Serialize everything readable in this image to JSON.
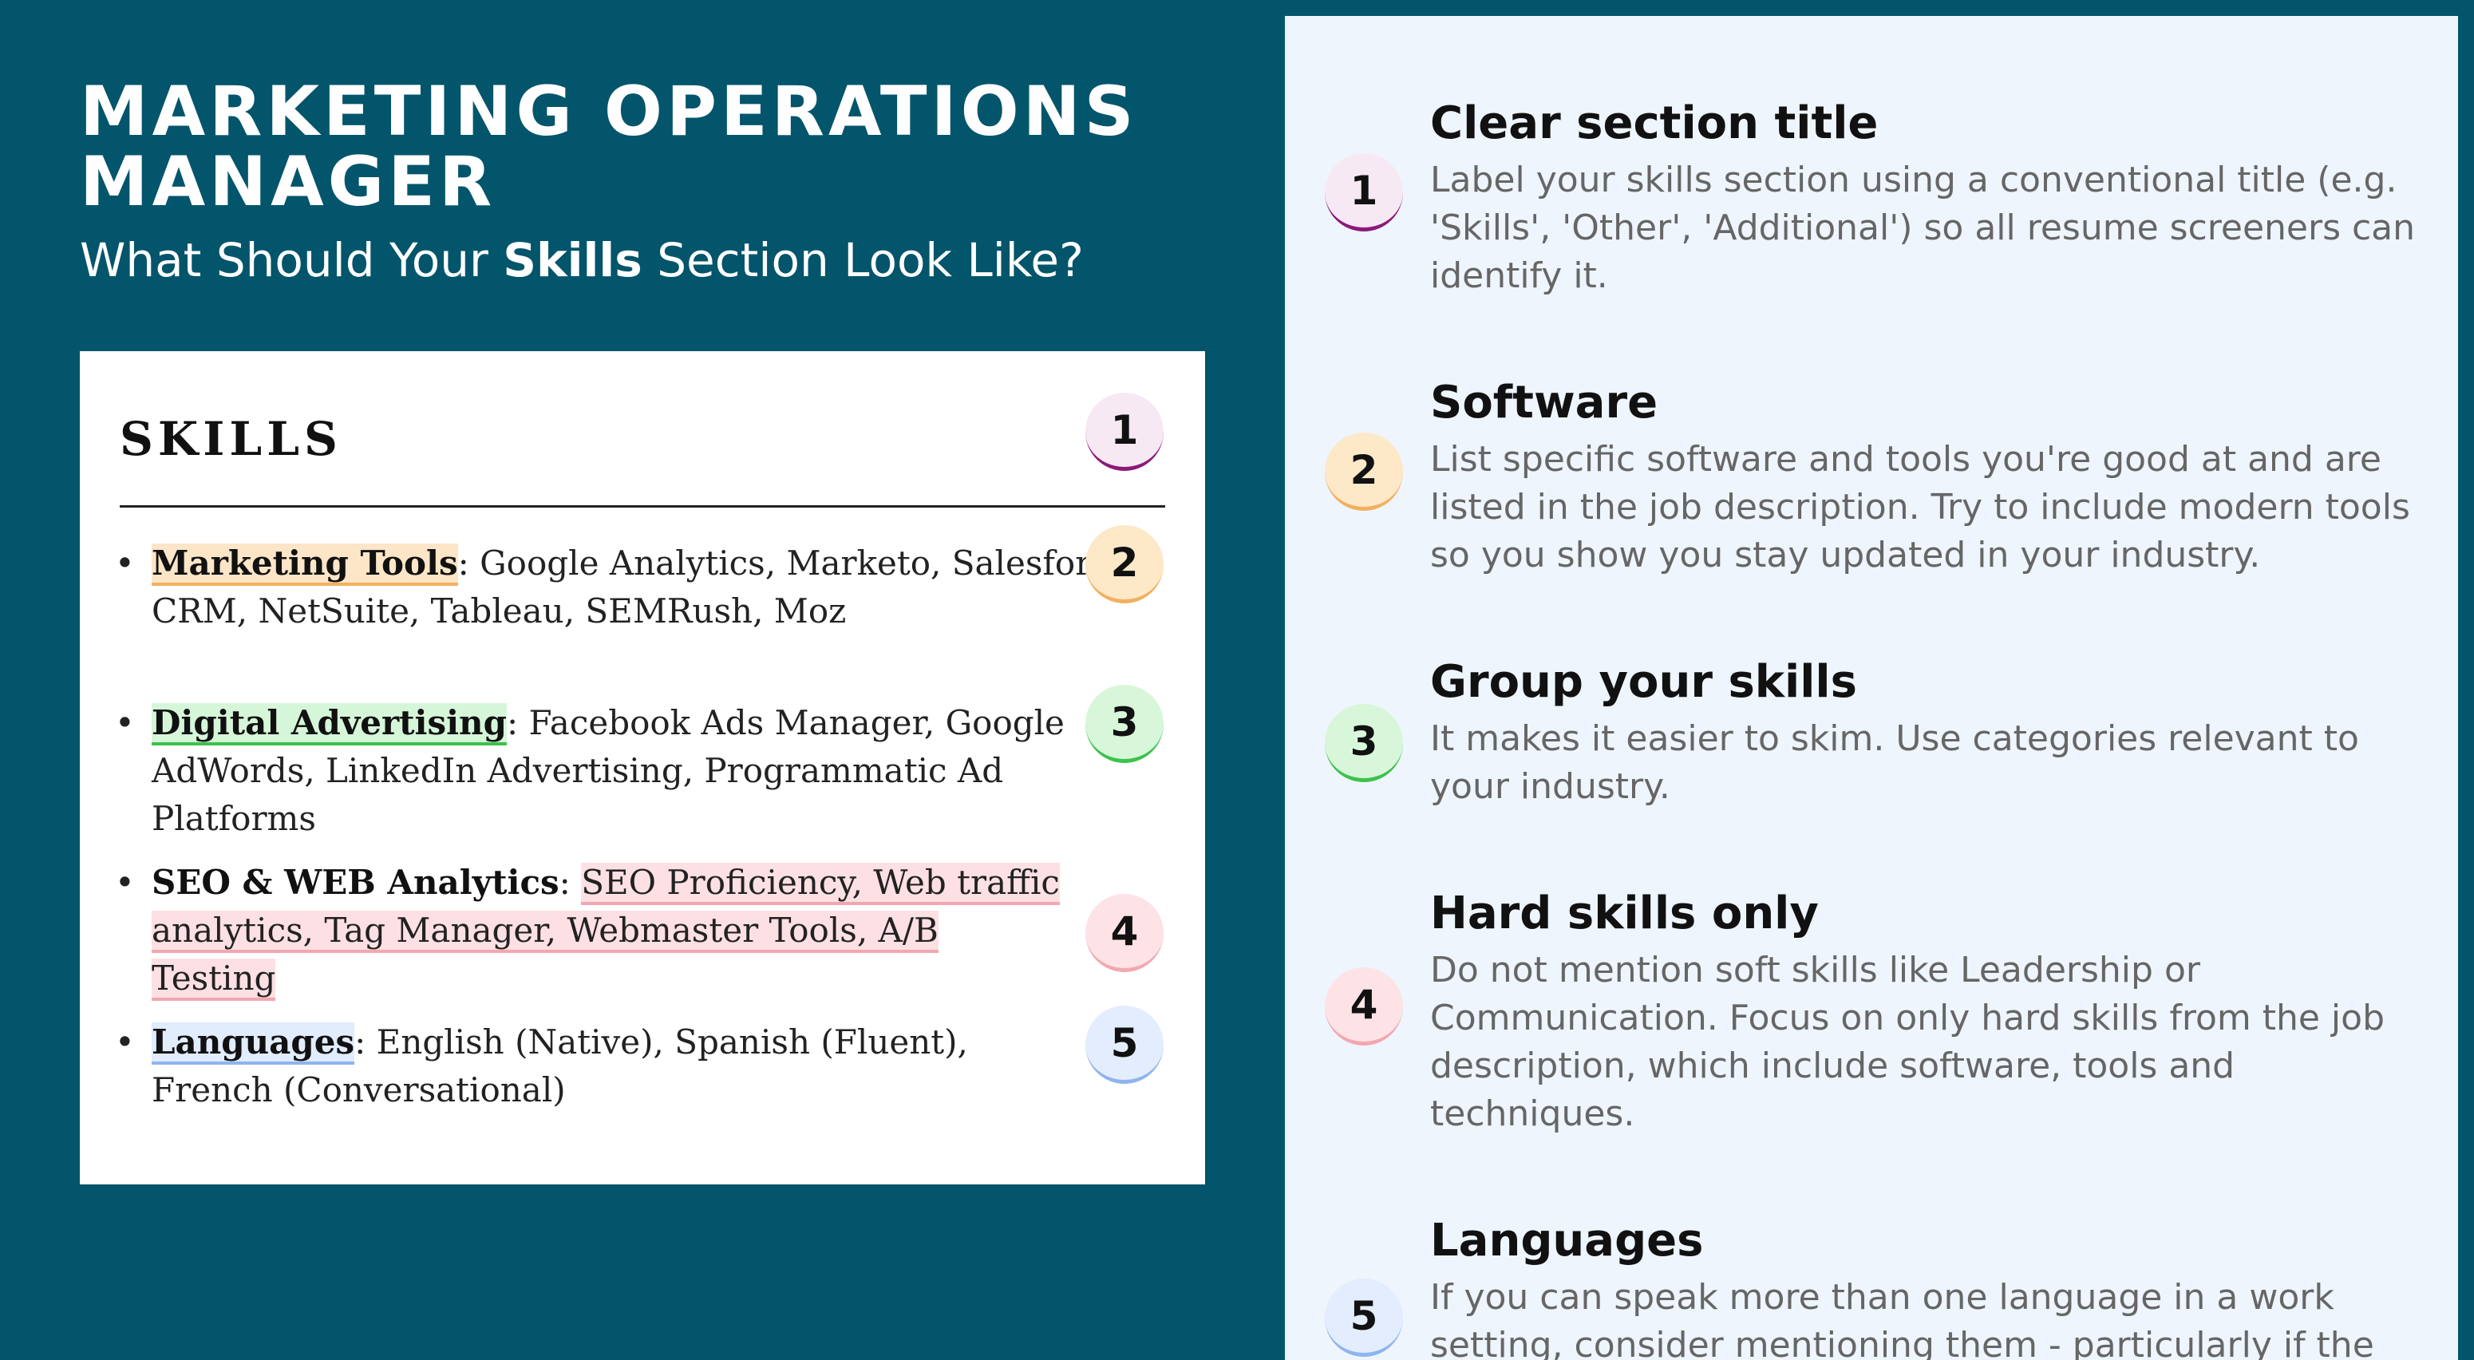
{
  "header": {
    "title": "MARKETING OPERATIONS MANAGER",
    "subtitle_before": "What Should Your ",
    "subtitle_bold": "Skills",
    "subtitle_after": " Section Look Like?"
  },
  "skills_card": {
    "heading": "SKILLS",
    "items": [
      {
        "category": "Marketing Tools",
        "separator": ": ",
        "text": "Google Analytics, Marketo, Salesforce CRM, NetSuite, Tableau, SEMRush, Moz",
        "badge": "2"
      },
      {
        "category": "Digital Advertising",
        "separator": ": ",
        "text": "Facebook Ads Manager, Google AdWords, LinkedIn Advertising, Programmatic Ad Platforms",
        "badge": "3"
      },
      {
        "category": "SEO & WEB Analytics",
        "separator": ": ",
        "text": "SEO Proficiency, Web traffic analytics, Tag Manager, Webmaster Tools, A/B Testing",
        "badge": "4"
      },
      {
        "category": "Languages",
        "separator": ": ",
        "text": "English (Native), Spanish (Fluent), French (Conversational)",
        "badge": "5"
      }
    ],
    "heading_badge": "1"
  },
  "tips": [
    {
      "number": "1",
      "title": "Clear section title",
      "description": "Label your skills section using a conventional title (e.g. 'Skills', 'Other', 'Additional') so all resume screeners can identify it."
    },
    {
      "number": "2",
      "title": "Software",
      "description": "List specific software and tools you're good at and are listed in the job description. Try to include modern tools so you show you stay updated in your industry."
    },
    {
      "number": "3",
      "title": "Group your skills",
      "description": "It makes it easier to skim. Use categories relevant to your industry."
    },
    {
      "number": "4",
      "title": "Hard skills only",
      "description": "Do not mention soft skills like Leadership or Communication. Focus on only hard skills from the job description, which include software, tools and techniques."
    },
    {
      "number": "5",
      "title": "Languages",
      "description": "If you can speak more than one language in a work setting, consider mentioning them - particularly if the job"
    }
  ],
  "colors": {
    "background": "#03556b",
    "panel": "#eef5fd",
    "badge_1": "#8a1a7a",
    "badge_2": "#f2b05e",
    "badge_3": "#3cc24c",
    "badge_4": "#f2a7b0",
    "badge_5": "#8fb4ef"
  }
}
